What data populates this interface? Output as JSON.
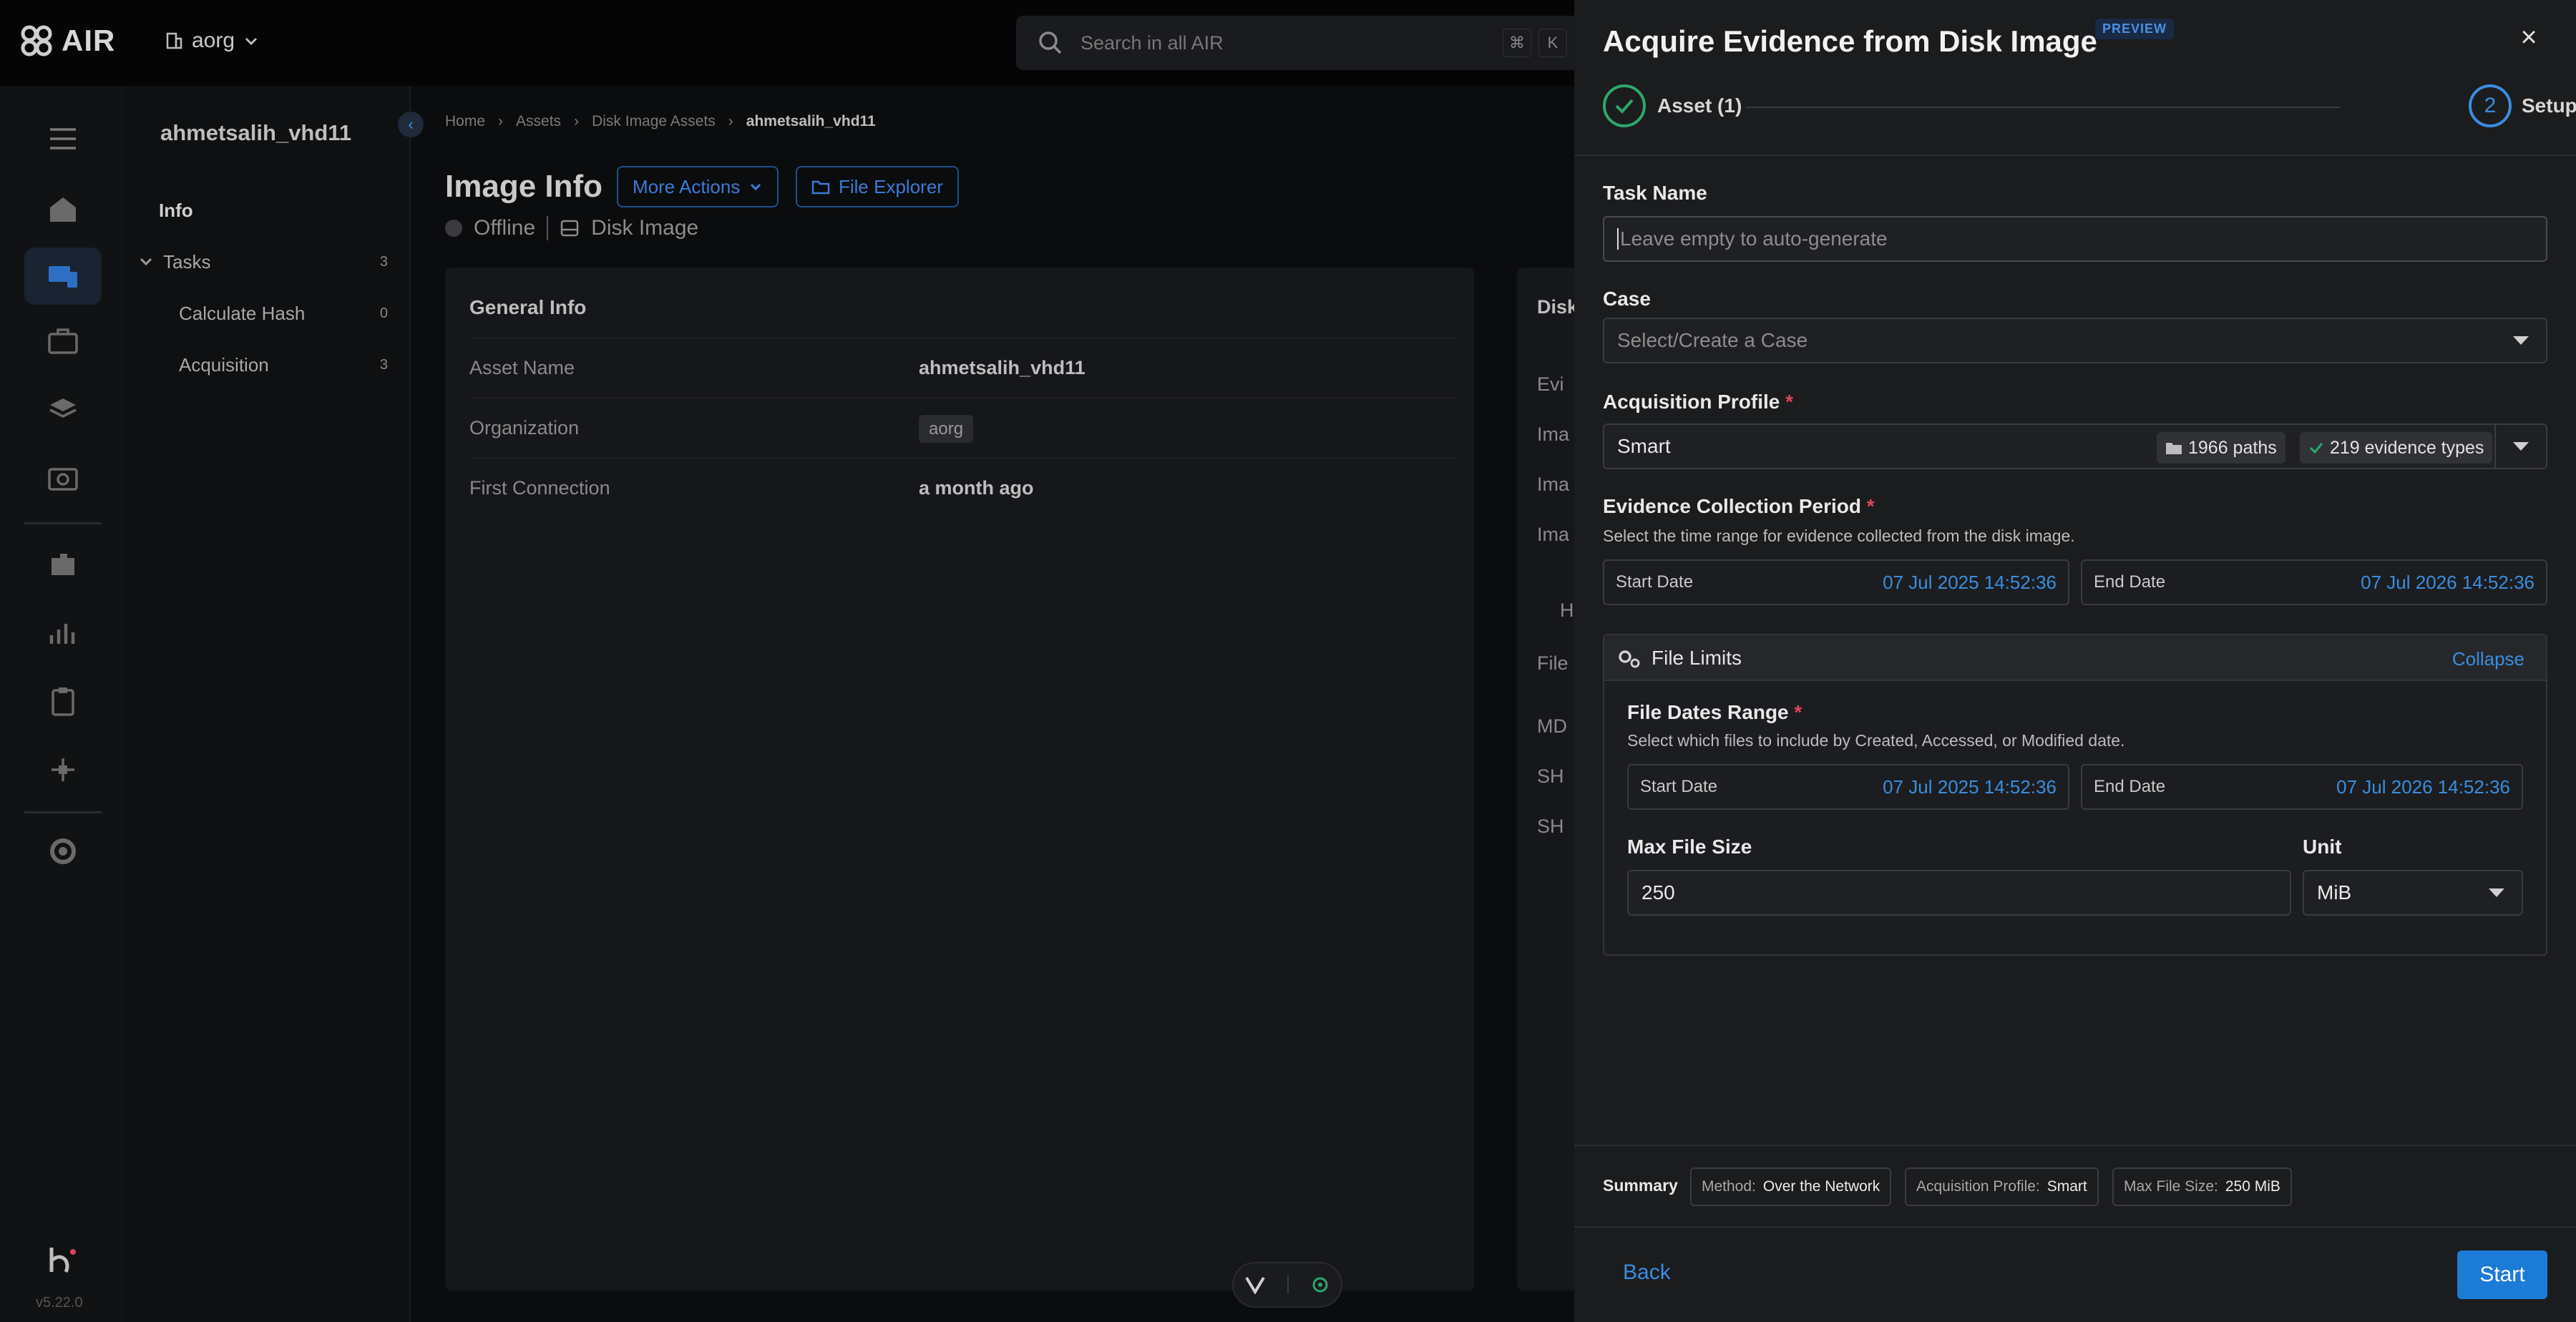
{
  "app": {
    "brand": "AIR",
    "org": "aorg",
    "version": "v5.22.0"
  },
  "search": {
    "placeholder": "Search in all AIR",
    "kbd1": "⌘",
    "kbd2": "K"
  },
  "subsidebar": {
    "asset_title": "ahmetsalih_vhd11",
    "items": [
      {
        "label": "Info",
        "count": ""
      },
      {
        "label": "Tasks",
        "count": "3"
      },
      {
        "label": "Calculate Hash",
        "count": "0"
      },
      {
        "label": "Acquisition",
        "count": "3"
      }
    ]
  },
  "breadcrumbs": [
    "Home",
    "Assets",
    "Disk Image Assets",
    "ahmetsalih_vhd11"
  ],
  "page": {
    "title": "Image Info",
    "more_actions": "More Actions",
    "file_explorer": "File Explorer",
    "status": "Offline",
    "type": "Disk Image"
  },
  "general_info": {
    "title": "General Info",
    "rows": [
      {
        "key": "Asset Name",
        "value": "ahmetsalih_vhd11"
      },
      {
        "key": "Organization",
        "value": "aorg"
      },
      {
        "key": "First Connection",
        "value": "a month ago"
      }
    ]
  },
  "side_card": {
    "title": "Disk",
    "lines": [
      "Evi",
      "Ima",
      "Ima",
      "Ima",
      "H",
      "File",
      "MD",
      "SH",
      "SH"
    ]
  },
  "drawer": {
    "title": "Acquire Evidence from Disk Image",
    "badge": "PREVIEW",
    "steps": [
      {
        "label": "Asset (1)",
        "state": "done"
      },
      {
        "label": "Setup",
        "number": "2",
        "state": "active"
      }
    ],
    "task_name": {
      "label": "Task Name",
      "placeholder": "Leave empty to auto-generate"
    },
    "case": {
      "label": "Case",
      "placeholder": "Select/Create a Case"
    },
    "profile": {
      "label": "Acquisition Profile",
      "value": "Smart",
      "paths": "1966 paths",
      "evidence": "219 evidence types"
    },
    "period": {
      "label": "Evidence Collection Period",
      "help": "Select the time range for evidence collected from the disk image.",
      "start_label": "Start Date",
      "start_value": "07 Jul 2025 14:52:36",
      "end_label": "End Date",
      "end_value": "07 Jul 2026 14:52:36"
    },
    "file_limits": {
      "title": "File Limits",
      "collapse": "Collapse",
      "range_label": "File Dates Range",
      "range_help": "Select which files to include by Created, Accessed, or Modified date.",
      "start_label": "Start Date",
      "start_value": "07 Jul 2025 14:52:36",
      "end_label": "End Date",
      "end_value": "07 Jul 2026 14:52:36",
      "max_size_label": "Max File Size",
      "max_size_value": "250",
      "unit_label": "Unit",
      "unit_value": "MiB"
    },
    "summary": {
      "label": "Summary",
      "chips": [
        {
          "key": "Method:",
          "value": "Over the Network"
        },
        {
          "key": "Acquisition Profile:",
          "value": "Smart"
        },
        {
          "key": "Max File Size:",
          "value": "250 MiB"
        }
      ]
    },
    "back": "Back",
    "start": "Start"
  },
  "colors": {
    "accent": "#1d7bd8",
    "success": "#2ea66a",
    "required": "#e0445a"
  }
}
